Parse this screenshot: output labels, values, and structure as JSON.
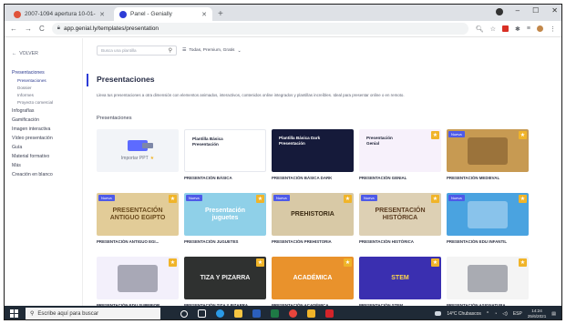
{
  "browser": {
    "tabs": [
      {
        "title": "2007-1094 apertura 10-01-11€ ...",
        "active": false,
        "fav_color": "#e0533a"
      },
      {
        "title": "Panel - Genially",
        "active": true,
        "fav_color": "#2d3cd6"
      }
    ],
    "new_tab": "+",
    "url": "app.genial.ly/templates/presentation",
    "nav": {
      "back": "←",
      "forward": "→",
      "reload": "C"
    }
  },
  "sidebar": {
    "back_label": "VOLVER",
    "items": [
      {
        "label": "Presentaciones",
        "sub": false,
        "active": true
      },
      {
        "label": "Presentaciones",
        "sub": true,
        "active": true
      },
      {
        "label": "Dossier",
        "sub": true,
        "active": false
      },
      {
        "label": "Informes",
        "sub": true,
        "active": false
      },
      {
        "label": "Proyecto comercial",
        "sub": true,
        "active": false
      },
      {
        "label": "Infografías",
        "sub": false,
        "active": false
      },
      {
        "label": "Gamificación",
        "sub": false,
        "active": false
      },
      {
        "label": "Imagen interactiva",
        "sub": false,
        "active": false
      },
      {
        "label": "Vídeo presentación",
        "sub": false,
        "active": false
      },
      {
        "label": "Guía",
        "sub": false,
        "active": false
      },
      {
        "label": "Material formativo",
        "sub": false,
        "active": false
      },
      {
        "label": "Más",
        "sub": false,
        "active": false
      },
      {
        "label": "Creación en blanco",
        "sub": false,
        "active": false
      }
    ]
  },
  "main": {
    "search_placeholder": "Busca una plantilla",
    "filter_label": "Todas, Premium, Gratis",
    "title": "Presentaciones",
    "description": "Lleva tus presentaciones a otra dimensión con elementos animados, interactivos, contenidos online integrados y plantillas increíbles. Ideal para presentar online o en remoto.",
    "section_title": "Presentaciones",
    "import_label": "Importar PPT",
    "new_badge": "Nueva",
    "templates": [
      {
        "label": "",
        "kind": "import",
        "new": false,
        "premium": false,
        "bg": "#f2f4f8",
        "fg": "#333",
        "thumb_text": ""
      },
      {
        "label": "PRESENTACIÓN BÁSICA",
        "kind": "text",
        "new": false,
        "premium": false,
        "bg": "#ffffff",
        "fg": "#1d2236",
        "thumb_text": "Plantilla Básica\nPresentación"
      },
      {
        "label": "PRESENTACIÓN BÁSICA DARK",
        "kind": "text",
        "new": false,
        "premium": false,
        "bg": "#151a3a",
        "fg": "#ffffff",
        "thumb_text": "Plantilla Básica Dark\nPresentación"
      },
      {
        "label": "PRESENTACIÓN GENIAL",
        "kind": "text",
        "new": false,
        "premium": true,
        "bg": "#f7f1fb",
        "fg": "#1d2236",
        "thumb_text": "Presentación\nGenial"
      },
      {
        "label": "PRESENTACIÓN MEDIEVAL",
        "kind": "art",
        "new": true,
        "premium": true,
        "bg": "#c79a52",
        "fg": "#4a2c10",
        "thumb_text": ""
      },
      {
        "label": "PRESENTACIÓN ANTIGUO EGI...",
        "kind": "art",
        "new": true,
        "premium": true,
        "bg": "#e2cc98",
        "fg": "#6a4a1c",
        "thumb_text": "PRESENTACIÓN\nANTIGUO EGIPTO"
      },
      {
        "label": "PRESENTACIÓN JUGUETES",
        "kind": "center",
        "new": true,
        "premium": true,
        "bg": "#8fd0e8",
        "fg": "#ffffff",
        "thumb_text": "Presentación\njuguetes"
      },
      {
        "label": "PRESENTACIÓN PREHISTORIA",
        "kind": "center",
        "new": true,
        "premium": true,
        "bg": "#d8c9a6",
        "fg": "#3a2a12",
        "thumb_text": "PREHISTORIA"
      },
      {
        "label": "PRESENTACIÓN HISTÓRICA",
        "kind": "center",
        "new": true,
        "premium": true,
        "bg": "#ddd0b4",
        "fg": "#5b3c20",
        "thumb_text": "PRESENTACIÓN\nHISTÓRICA"
      },
      {
        "label": "PRESENTACIÓN EDU INFANTIL",
        "kind": "art",
        "new": true,
        "premium": true,
        "bg": "#4aa3e0",
        "fg": "#ffffff",
        "thumb_text": ""
      },
      {
        "label": "PRESENTACIÓN EDU SUPERIOR",
        "kind": "art",
        "new": false,
        "premium": true,
        "bg": "#f3f0fb",
        "fg": "#1d2236",
        "thumb_text": ""
      },
      {
        "label": "PRESENTACIÓN TIZA Y PIZARRA",
        "kind": "center",
        "new": false,
        "premium": true,
        "bg": "#2f3130",
        "fg": "#f2f2f2",
        "thumb_text": "TIZA Y PIZARRA"
      },
      {
        "label": "PRESENTACIÓN ACADÉMICA",
        "kind": "center",
        "new": false,
        "premium": true,
        "bg": "#e9922c",
        "fg": "#ffffff",
        "thumb_text": "ACADÉMICA"
      },
      {
        "label": "PRESENTACIÓN STEM",
        "kind": "center",
        "new": false,
        "premium": true,
        "bg": "#3a2fb0",
        "fg": "#ffd84a",
        "thumb_text": "STEM"
      },
      {
        "label": "PRESENTACIÓN ASIGNATURA",
        "kind": "art",
        "new": false,
        "premium": true,
        "bg": "#f4f4f4",
        "fg": "#1d2236",
        "thumb_text": ""
      }
    ]
  },
  "taskbar": {
    "search_placeholder": "Escribe aquí para buscar",
    "weather": "14°C  Chubascos",
    "lang": "ESP",
    "time": "14:24",
    "date": "25/6/2021"
  }
}
